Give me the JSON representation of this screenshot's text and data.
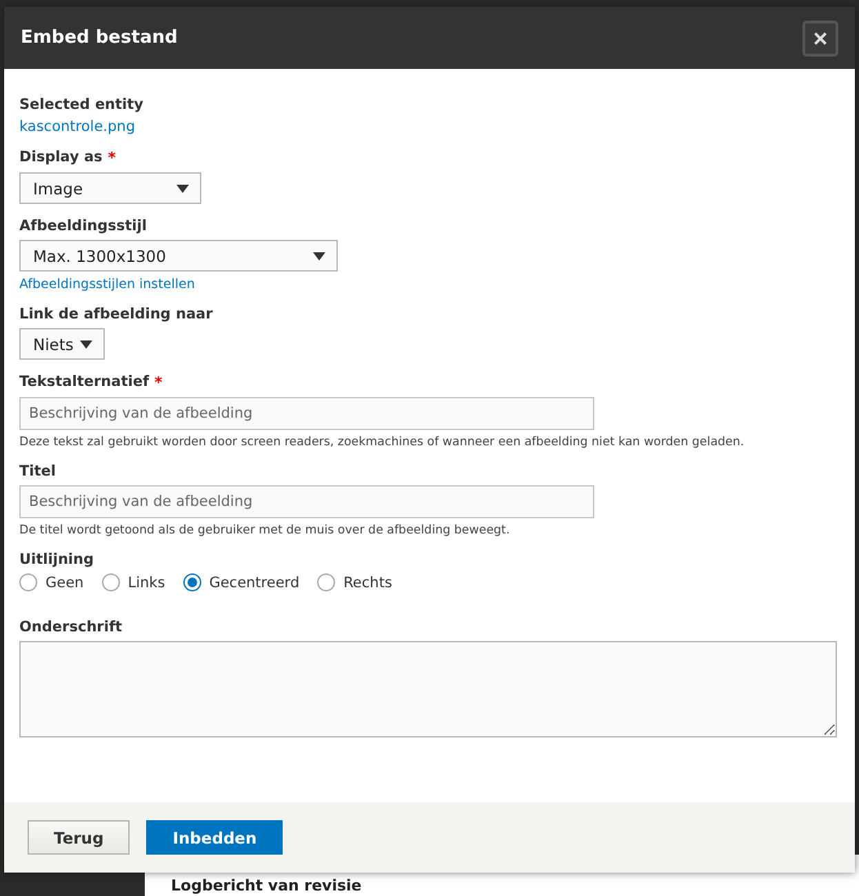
{
  "dialog": {
    "title": "Embed bestand",
    "close": "×"
  },
  "fields": [
    {
      "kind": "link",
      "label": "Selected entity",
      "value": "kascontrole.png"
    },
    {
      "kind": "select",
      "label": "Display as",
      "required_mark": "*",
      "value": "Image"
    },
    {
      "kind": "select",
      "label": "Afbeeldingsstijl",
      "value": "Max. 1300x1300",
      "link": "Afbeeldingsstijlen instellen"
    },
    {
      "kind": "select",
      "label": "Link de afbeelding naar",
      "value": "Niets"
    },
    {
      "kind": "text",
      "label": "Tekstalternatief",
      "required_mark": "*",
      "placeholder": "Beschrijving van de afbeelding",
      "description": "Deze tekst zal gebruikt worden door screen readers, zoekmachines of wanneer een afbeelding niet kan worden geladen."
    },
    {
      "kind": "text",
      "label": "Titel",
      "placeholder": "Beschrijving van de afbeelding",
      "description": "De titel wordt getoond als de gebruiker met de muis over de afbeelding beweegt."
    },
    {
      "kind": "radios",
      "label": "Uitlijning",
      "options": [
        {
          "label": "Geen",
          "selected": false
        },
        {
          "label": "Links",
          "selected": false
        },
        {
          "label": "Gecentreerd",
          "selected": true
        },
        {
          "label": "Rechts",
          "selected": false
        }
      ]
    },
    {
      "kind": "textarea",
      "label": "Onderschrift"
    }
  ],
  "buttons": [
    {
      "label": "Terug",
      "kind": "secondary"
    },
    {
      "label": "Inbedden",
      "kind": "primary"
    }
  ],
  "background_page": {
    "label": "Logbericht van revisie"
  }
}
